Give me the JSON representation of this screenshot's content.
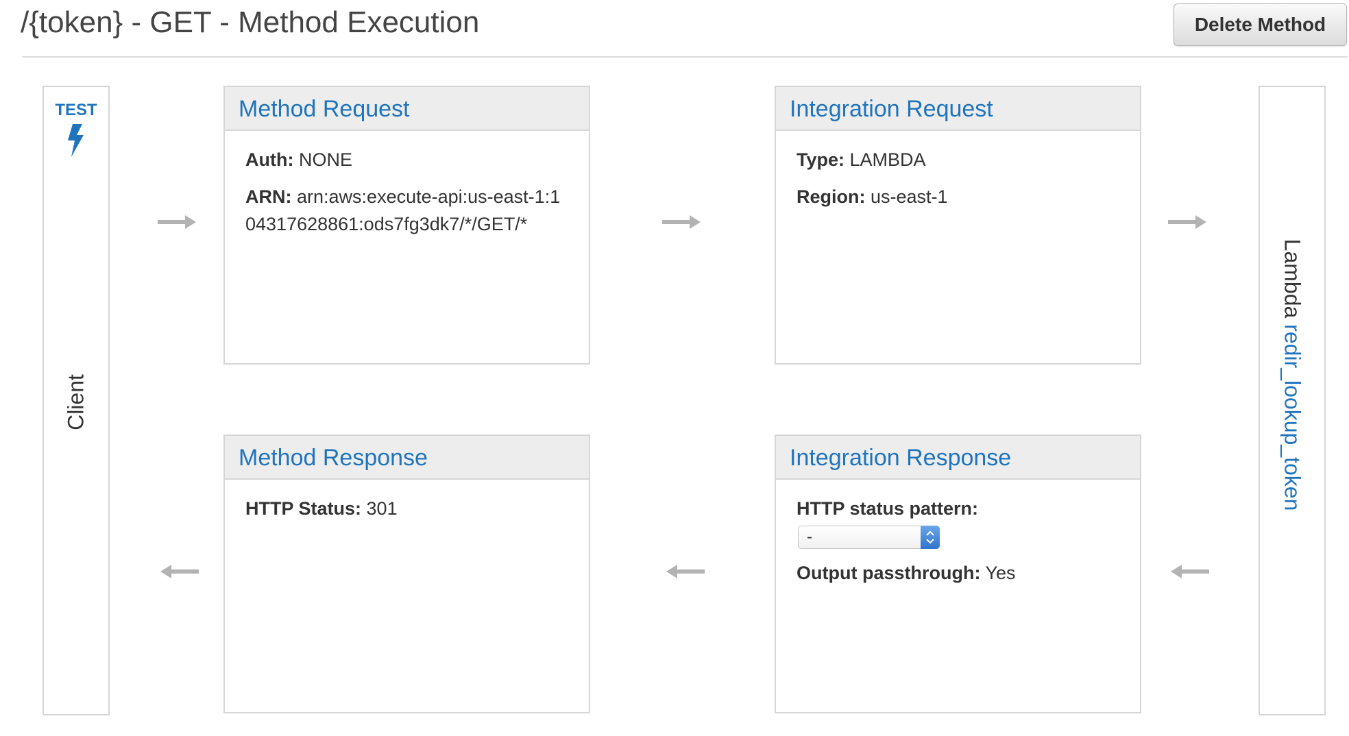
{
  "header": {
    "title": "/{token} - GET - Method Execution",
    "delete_label": "Delete Method"
  },
  "client": {
    "test_label": "TEST",
    "label": "Client",
    "test_icon": "lightning-bolt-icon"
  },
  "lambda": {
    "prefix": "Lambda",
    "function_name": "redir_lookup_token"
  },
  "method_request": {
    "title": "Method Request",
    "auth_label": "Auth:",
    "auth_value": "NONE",
    "arn_label": "ARN:",
    "arn_value": "arn:aws:execute-api:us-east-1:104317628861:ods7fg3dk7/*/GET/*"
  },
  "integration_request": {
    "title": "Integration Request",
    "type_label": "Type:",
    "type_value": "LAMBDA",
    "region_label": "Region:",
    "region_value": "us-east-1"
  },
  "method_response": {
    "title": "Method Response",
    "status_label": "HTTP Status:",
    "status_value": "301"
  },
  "integration_response": {
    "title": "Integration Response",
    "pattern_label": "HTTP status pattern:",
    "pattern_value": "-",
    "passthrough_label": "Output passthrough:",
    "passthrough_value": "Yes"
  },
  "colors": {
    "link": "#1f74be",
    "arrow": "#b3b3b3",
    "border": "#d6d6d6",
    "header_bg": "#ededed"
  },
  "icons": {
    "arrow_right": "arrow-right-icon",
    "arrow_left": "arrow-left-icon"
  }
}
